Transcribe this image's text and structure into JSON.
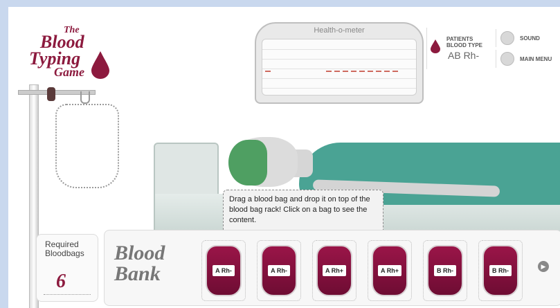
{
  "logo": {
    "the": "The",
    "blood": "Blood",
    "typing": "Typing",
    "game": "Game"
  },
  "meter": {
    "title": "Health-o-meter"
  },
  "patient": {
    "label": "PATIENTS BLOOD TYPE",
    "type": "AB Rh-"
  },
  "menu": {
    "sound": "SOUND",
    "main_menu": "MAIN MENU"
  },
  "tooltip": {
    "text": "Drag a blood bag and drop it on top of the blood bag rack! Click on a bag to see the content."
  },
  "required": {
    "label": "Required Bloodbags",
    "count": "6"
  },
  "bank": {
    "title_line1": "Blood",
    "title_line2": "Bank",
    "bags": [
      "A Rh-",
      "A Rh-",
      "A Rh+",
      "A Rh+",
      "B Rh-",
      "B Rh-"
    ]
  },
  "colors": {
    "brand": "#8c1a3e",
    "blanket": "#4aa394",
    "hair": "#4f9f62"
  }
}
